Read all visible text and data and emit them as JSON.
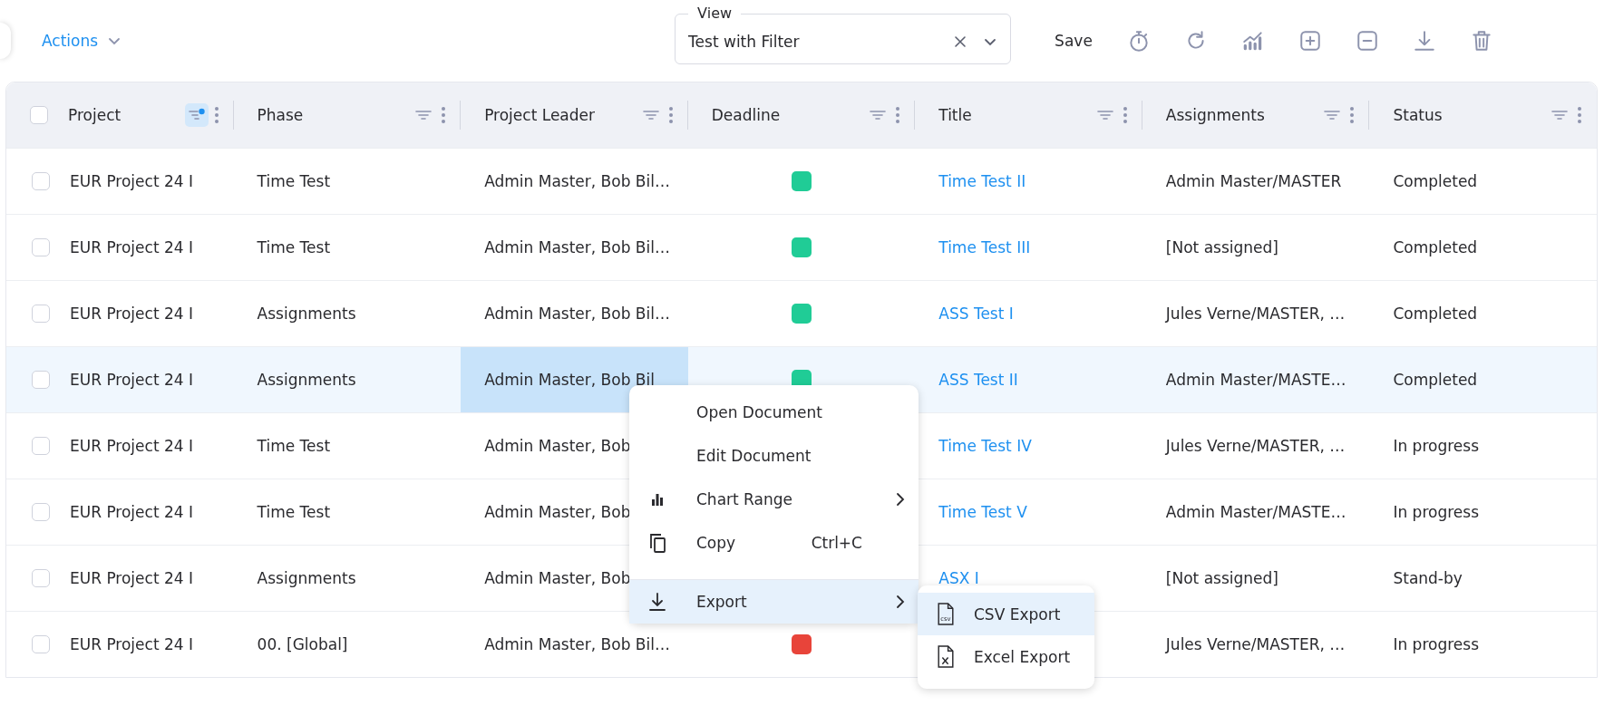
{
  "toolbar": {
    "actions_label": "Actions",
    "view": {
      "label": "View",
      "value": "Test with Filter"
    },
    "save_label": "Save"
  },
  "table": {
    "header_checked": false,
    "columns": [
      {
        "label": "Project",
        "filter_active": true
      },
      {
        "label": "Phase",
        "filter_active": false
      },
      {
        "label": "Project Leader",
        "filter_active": false
      },
      {
        "label": "Deadline",
        "filter_active": false
      },
      {
        "label": "Title",
        "filter_active": false
      },
      {
        "label": "Assignments",
        "filter_active": false
      },
      {
        "label": "Status",
        "filter_active": false
      }
    ],
    "rows": [
      {
        "checked": false,
        "selected": false,
        "leader_focused": false,
        "project": "EUR Project 24 I",
        "phase": "Time Test",
        "leader": "Admin Master, Bob Bil…",
        "color": "#20cc96",
        "title": "Time Test II",
        "assignments": "Admin Master/MASTER",
        "status": "Completed"
      },
      {
        "checked": false,
        "selected": false,
        "leader_focused": false,
        "project": "EUR Project 24 I",
        "phase": "Time Test",
        "leader": "Admin Master, Bob Bil…",
        "color": "#20cc96",
        "title": "Time Test III",
        "assignments": "[Not assigned]",
        "status": "Completed"
      },
      {
        "checked": false,
        "selected": false,
        "leader_focused": false,
        "project": "EUR Project 24 I",
        "phase": "Assignments",
        "leader": "Admin Master, Bob Bil…",
        "color": "#20cc96",
        "title": "ASS Test I",
        "assignments": "Jules Verne/MASTER, …",
        "status": "Completed"
      },
      {
        "checked": false,
        "selected": true,
        "leader_focused": true,
        "project": "EUR Project 24 I",
        "phase": "Assignments",
        "leader": "Admin Master, Bob Bil",
        "color": "#20cc96",
        "title": "ASS Test II",
        "assignments": "Admin Master/MASTE…",
        "status": "Completed"
      },
      {
        "checked": false,
        "selected": false,
        "leader_focused": false,
        "project": "EUR Project 24 I",
        "phase": "Time Test",
        "leader": "Admin Master, Bob",
        "title": "Time Test IV",
        "assignments": "Jules Verne/MASTER, …",
        "status": "In progress"
      },
      {
        "checked": false,
        "selected": false,
        "leader_focused": false,
        "project": "EUR Project 24 I",
        "phase": "Time Test",
        "leader": "Admin Master, Bob",
        "title": "Time Test V",
        "assignments": "Admin Master/MASTE…",
        "status": "In progress"
      },
      {
        "checked": false,
        "selected": false,
        "leader_focused": false,
        "project": "EUR Project 24 I",
        "phase": "Assignments",
        "leader": "Admin Master, Bob",
        "title": "ASX I",
        "assignments": "[Not assigned]",
        "status": "Stand-by"
      },
      {
        "checked": false,
        "selected": false,
        "leader_focused": false,
        "project": "EUR Project 24 I",
        "phase": "00. [Global]",
        "leader": "Admin Master, Bob Bil…",
        "color": "#e8443a",
        "assignments": "Jules Verne/MASTER, …",
        "status": "In progress"
      }
    ]
  },
  "context_menu": {
    "items": [
      {
        "kind": "plain",
        "label": "Open Document",
        "has_submenu": false,
        "selected": false
      },
      {
        "kind": "plain",
        "label": "Edit Document",
        "has_submenu": false,
        "selected": false
      },
      {
        "kind": "chart",
        "label": "Chart Range",
        "has_submenu": true,
        "selected": false
      },
      {
        "kind": "copy",
        "label": "Copy",
        "shortcut": "Ctrl+C",
        "has_submenu": false,
        "selected": false
      },
      {
        "kind": "export",
        "label": "Export",
        "has_submenu": true,
        "selected": true
      }
    ]
  },
  "submenu": {
    "items": [
      {
        "kind": "csv",
        "label": "CSV Export",
        "selected": true
      },
      {
        "kind": "excel",
        "label": "Excel Export",
        "selected": false
      }
    ]
  }
}
